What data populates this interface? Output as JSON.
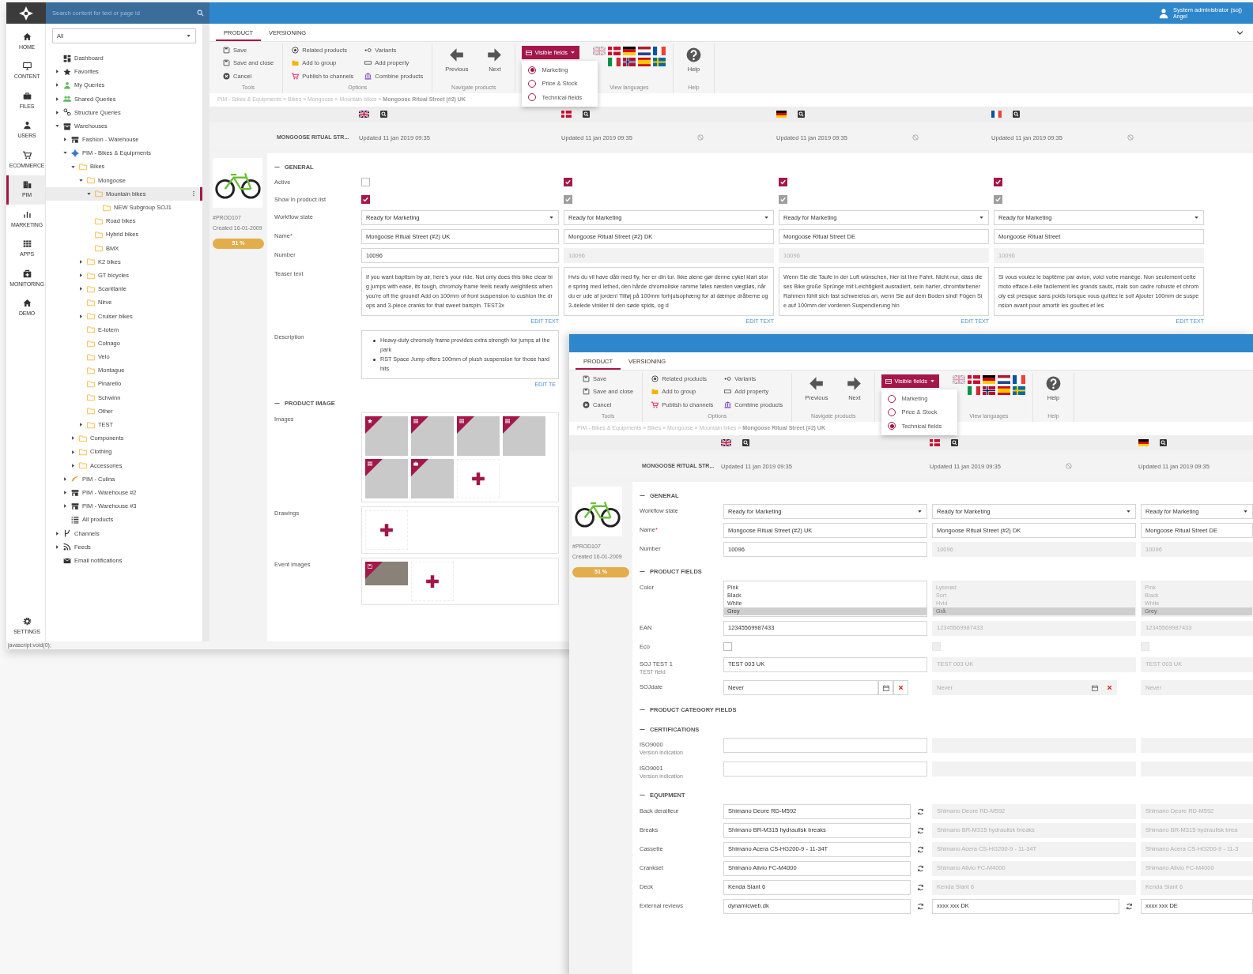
{
  "back_window": {
    "search": {
      "placeholder": "Search content for text or page id"
    },
    "user": {
      "name": "System administrator (soj)",
      "role": "Angel"
    },
    "rail": [
      {
        "label": "HOME",
        "kind": "home",
        "selected": false
      },
      {
        "label": "CONTENT",
        "kind": "monitor",
        "selected": false
      },
      {
        "label": "FILES",
        "kind": "briefcase",
        "selected": false
      },
      {
        "label": "USERS",
        "kind": "user",
        "selected": false
      },
      {
        "label": "ECOMMERCE",
        "kind": "cart",
        "selected": false
      },
      {
        "label": "PIM",
        "kind": "building",
        "selected": true
      },
      {
        "label": "MARKETING",
        "kind": "chart",
        "selected": false
      },
      {
        "label": "APPS",
        "kind": "grid",
        "selected": false
      },
      {
        "label": "MONITORING",
        "kind": "medkit",
        "selected": false
      },
      {
        "label": "DEMO",
        "kind": "home",
        "selected": false
      }
    ],
    "settings": {
      "label": "SETTINGS"
    },
    "tree_filter": {
      "value": "All"
    },
    "tree": [
      {
        "label": "Dashboard",
        "kind": "dashboard",
        "selected": false
      },
      {
        "label": "Favorites",
        "kind": "star",
        "selected": false,
        "expanded": false
      },
      {
        "label": "My Queries",
        "kind": "user",
        "selected": false,
        "expanded": false
      },
      {
        "label": "Shared Queries",
        "kind": "users",
        "selected": false,
        "expanded": false
      },
      {
        "label": "Structure Queries",
        "kind": "link",
        "selected": false,
        "expanded": false
      },
      {
        "label": "Warehouses",
        "kind": "archive",
        "selected": false,
        "expanded": true,
        "children": [
          {
            "label": "Fashion - Warehouse",
            "kind": "store",
            "selected": false,
            "expanded": false
          },
          {
            "label": "PIM - Bikes & Equipments",
            "kind": "logo",
            "selected": false,
            "expanded": true,
            "children": [
              {
                "label": "Bikes",
                "kind": "folder",
                "selected": false,
                "expanded": true,
                "children": [
                  {
                    "label": "Mongoose",
                    "kind": "folder",
                    "selected": false,
                    "expanded": true,
                    "children": [
                      {
                        "label": "Mountain bikes",
                        "kind": "folder",
                        "selected": true,
                        "expanded": true,
                        "children": [
                          {
                            "label": "NEW Subgroup SOJ1",
                            "kind": "folder",
                            "selected": false
                          }
                        ]
                      },
                      {
                        "label": "Road bikes",
                        "kind": "folder",
                        "selected": false
                      },
                      {
                        "label": "Hybrid bikes",
                        "kind": "folder",
                        "selected": false
                      },
                      {
                        "label": "BMX",
                        "kind": "folder",
                        "selected": false
                      }
                    ]
                  },
                  {
                    "label": "K2 bikes",
                    "kind": "folder",
                    "selected": false,
                    "expanded": false
                  },
                  {
                    "label": "GT bicycles",
                    "kind": "folder",
                    "selected": false,
                    "expanded": false
                  },
                  {
                    "label": "Scanttante",
                    "kind": "folder",
                    "selected": false,
                    "expanded": false
                  },
                  {
                    "label": "Nirve",
                    "kind": "folder",
                    "selected": false
                  },
                  {
                    "label": "Cruiser bikes",
                    "kind": "folder",
                    "selected": false,
                    "expanded": false
                  },
                  {
                    "label": "E-totem",
                    "kind": "folder",
                    "selected": false
                  },
                  {
                    "label": "Colnago",
                    "kind": "folder",
                    "selected": false
                  },
                  {
                    "label": "Velo",
                    "kind": "folder",
                    "selected": false
                  },
                  {
                    "label": "Montague",
                    "kind": "folder",
                    "selected": false
                  },
                  {
                    "label": "Pinarello",
                    "kind": "folder",
                    "selected": false
                  },
                  {
                    "label": "Schwinn",
                    "kind": "folder",
                    "selected": false
                  },
                  {
                    "label": "Other",
                    "kind": "folder",
                    "selected": false
                  },
                  {
                    "label": "TEST",
                    "kind": "folder",
                    "selected": false,
                    "expanded": false
                  }
                ]
              },
              {
                "label": "Components",
                "kind": "folder",
                "selected": false,
                "expanded": false
              },
              {
                "label": "Clothing",
                "kind": "folder",
                "selected": false,
                "expanded": false
              },
              {
                "label": "Accessories",
                "kind": "folder",
                "selected": false,
                "expanded": false
              }
            ]
          },
          {
            "label": "PIM - Culina",
            "kind": "culina",
            "selected": false,
            "expanded": false
          },
          {
            "label": "PIM - Warehouse #2",
            "kind": "store",
            "selected": false,
            "expanded": false
          },
          {
            "label": "PIM - Warehouse #3",
            "kind": "store",
            "selected": false,
            "expanded": false
          },
          {
            "label": "All products",
            "kind": "list",
            "selected": false
          }
        ]
      },
      {
        "label": "Channels",
        "kind": "branch",
        "selected": false,
        "expanded": false
      },
      {
        "label": "Feeds",
        "kind": "rss",
        "selected": false,
        "expanded": false
      },
      {
        "label": "Email notifications",
        "kind": "mail",
        "selected": false
      }
    ],
    "editor": {
      "tabs": [
        {
          "label": "PRODUCT",
          "selected": true
        },
        {
          "label": "VERSIONING",
          "selected": false
        }
      ],
      "toolbar": [
        {
          "kind": "list",
          "caption": "Tools",
          "columns": [
            [
              {
                "label": "Save",
                "kind": "save"
              },
              {
                "label": "Save and close",
                "kind": "save"
              },
              {
                "label": "Cancel",
                "kind": "cancel"
              }
            ]
          ]
        },
        {
          "kind": "list",
          "caption": "Options",
          "columns": [
            [
              {
                "label": "Related products",
                "kind": "related"
              },
              {
                "label": "Add to group",
                "kind": "folder-fill"
              },
              {
                "label": "Publish to channels",
                "kind": "cart"
              }
            ],
            [
              {
                "label": "Variants",
                "kind": "variants"
              },
              {
                "label": "Add property",
                "kind": "property"
              },
              {
                "label": "Combine products",
                "kind": "combine"
              }
            ]
          ]
        },
        {
          "kind": "big",
          "caption": "Navigate products",
          "items": [
            {
              "label": "Previous",
              "kind": "arrow-left"
            },
            {
              "label": "Next",
              "kind": "arrow-right"
            }
          ]
        },
        {
          "kind": "dropdown",
          "label": "Visible fields",
          "options": [
            {
              "label": "Marketing",
              "selected": true
            },
            {
              "label": "Price & Stock",
              "selected": false
            },
            {
              "label": "Technical fields",
              "selected": false
            }
          ]
        },
        {
          "kind": "flags",
          "caption": "View languages",
          "rows": [
            [
              {
                "kind": "uk",
                "faded": true
              },
              {
                "kind": "dk",
                "faded": false
              },
              {
                "kind": "de",
                "faded": false
              },
              {
                "kind": "nl",
                "faded": false
              },
              {
                "kind": "fr",
                "faded": false
              }
            ],
            [
              {
                "kind": "it",
                "faded": false
              },
              {
                "kind": "no",
                "faded": false
              },
              {
                "kind": "es",
                "faded": false
              },
              {
                "kind": "se",
                "faded": false
              }
            ]
          ]
        },
        {
          "kind": "big",
          "caption": "Help",
          "items": [
            {
              "label": "Help",
              "kind": "help"
            }
          ]
        }
      ],
      "breadcrumb": "PIM - Bikes & Equipments » Bikes » Mongoose » Mountain bikes » **Mongoose Ritual Street (#2) UK**",
      "title": "MONGOOSE RITUAL STR...",
      "columns": [
        {
          "kind": "uk",
          "updated": "Updated 11 jan 2019 09:35",
          "blocked": false
        },
        {
          "kind": "dk",
          "updated": "Updated 11 jan 2019 09:35",
          "blocked": true
        },
        {
          "kind": "de",
          "updated": "Updated 11 jan 2019 09:35",
          "blocked": true
        },
        {
          "kind": "fr",
          "updated": "Updated 11 jan 2019 09:35",
          "blocked": true
        }
      ],
      "product": {
        "id": "#PROD107",
        "created": "Created 16-01-2009",
        "completeness": "51 %"
      },
      "sections": [
        {
          "title": "GENERAL",
          "fields": [
            {
              "label": "Active",
              "kind": "checkbox",
              "values": [
                {
                  "checked": false,
                  "disabled": false
                },
                {
                  "checked": true,
                  "disabled": false
                },
                {
                  "checked": true,
                  "disabled": false
                },
                {
                  "checked": true,
                  "disabled": false
                }
              ]
            },
            {
              "label": "Show in product list",
              "kind": "checkbox",
              "values": [
                {
                  "checked": true,
                  "disabled": false
                },
                {
                  "checked": true,
                  "disabled": true
                },
                {
                  "checked": true,
                  "disabled": true
                },
                {
                  "checked": true,
                  "disabled": true
                }
              ]
            },
            {
              "label": "Workflow state",
              "kind": "select",
              "values": [
                {
                  "value": "Ready for Marketing",
                  "disabled": false
                },
                {
                  "value": "Ready for Marketing",
                  "disabled": false
                },
                {
                  "value": "Ready for Marketing",
                  "disabled": false
                },
                {
                  "value": "Ready for Marketing",
                  "disabled": false
                }
              ]
            },
            {
              "label": "Name",
              "required_mark": "*",
              "kind": "text",
              "values": [
                {
                  "value": "Mongoose Ritual Street (#2) UK",
                  "disabled": false
                },
                {
                  "value": "Mongoose Ritual Street (#2) DK",
                  "disabled": false
                },
                {
                  "value": "Mongoose Ritual Street DE",
                  "disabled": false
                },
                {
                  "value": "Mongoose Ritual Street",
                  "disabled": false
                }
              ]
            },
            {
              "label": "Number",
              "kind": "text",
              "values": [
                {
                  "value": "10096",
                  "disabled": false
                },
                {
                  "value": "10096",
                  "disabled": true
                },
                {
                  "value": "10096",
                  "disabled": true
                },
                {
                  "value": "10096",
                  "disabled": true
                }
              ]
            },
            {
              "label": "Teaser text",
              "kind": "textarea",
              "values": [
                {
                  "value": "If you want baptism by air, here's your ride. Not only does this bike clear big jumps with ease, its tough, chromoly frame feels nearly weightless when you're off the ground! Add on 100mm of front suspension to cushion the drops and 3-piece cranks for that sweet barspin. TEST3x",
                  "action": "EDIT TEXT"
                },
                {
                  "value": "Hvis du vil have dåb med fly, her er din tur. Ikke alene gør denne cykel klart store spring med lethed, den hårde chromoliske ramme føles næsten vægtløs, når du er ude af jorden! Tilføj på 100mm forhjulsophæng for at dæmpe dråberne og 3-delede vinkler til den søde spids, og d",
                  "action": "EDIT TEXT"
                },
                {
                  "value": "Wenn Sie die Taufe in der Luft wünschen, hier ist Ihre Fahrt. Nicht nur, dass dieses Bike große Sprünge mit Leichtigkeit ausradiert, sein harter, chromfarbener Rahmen fühlt sich fast schwerelos an, wenn Sie auf dem Boden sind! Fügen Sie auf 100mm der vorderen Suspendierung hin",
                  "action": "EDIT TEXT"
                },
                {
                  "value": "Si vous voulez le baptême par avion, voici votre manège. Non seulement cette moto efface-t-elle facilement les grands sauts, mais son cadre robuste et chromoly est presque sans poids lorsque vous quittez le sol! Ajouter 100mm de suspension avant pour amortir les gouttes et les",
                  "action": "EDIT TEXT"
                }
              ]
            },
            {
              "label": "Description",
              "kind": "richtext",
              "values": [
                {
                  "items": [
                    "Heavy-duty chromoly frame provides extra strength for jumps at the park",
                    "RST Space Jump offers 100mm of plush suspension for those hard hits"
                  ],
                  "action": "EDIT TE"
                }
              ]
            }
          ]
        },
        {
          "title": "PRODUCT IMAGE",
          "fields": [
            {
              "label": "Images",
              "kind": "gallery",
              "values": [
                {
                  "tiles": [
                    {
                      "kind": "starred"
                    },
                    {
                      "kind": "photo"
                    },
                    {
                      "kind": "photo"
                    },
                    {
                      "kind": "photo"
                    },
                    {
                      "kind": "photo"
                    },
                    {
                      "kind": "camera"
                    },
                    {
                      "kind": "add"
                    }
                  ]
                }
              ]
            },
            {
              "label": "Drawings",
              "kind": "gallery",
              "values": [
                {
                  "tiles": [
                    {
                      "kind": "add"
                    }
                  ]
                }
              ]
            },
            {
              "label": "Event images",
              "kind": "gallery",
              "values": [
                {
                  "tiles": [
                    {
                      "kind": "event"
                    },
                    {
                      "kind": "add"
                    }
                  ]
                }
              ]
            }
          ]
        }
      ]
    }
  },
  "status_bar": "javascript:void(0);",
  "front_window": {
    "editor": {
      "tabs": [
        {
          "label": "PRODUCT",
          "selected": true
        },
        {
          "label": "VERSIONING",
          "selected": false
        }
      ],
      "toolbar": [
        {
          "kind": "list",
          "caption": "Tools",
          "columns": [
            [
              {
                "label": "Save",
                "kind": "save"
              },
              {
                "label": "Save and close",
                "kind": "save"
              },
              {
                "label": "Cancel",
                "kind": "cancel"
              }
            ]
          ]
        },
        {
          "kind": "list",
          "caption": "Options",
          "columns": [
            [
              {
                "label": "Related products",
                "kind": "related"
              },
              {
                "label": "Add to group",
                "kind": "folder-fill"
              },
              {
                "label": "Publish to channels",
                "kind": "cart"
              }
            ],
            [
              {
                "label": "Variants",
                "kind": "variants"
              },
              {
                "label": "Add property",
                "kind": "property"
              },
              {
                "label": "Combine products",
                "kind": "combine"
              }
            ]
          ]
        },
        {
          "kind": "big",
          "caption": "Navigate products",
          "items": [
            {
              "label": "Previous",
              "kind": "arrow-left"
            },
            {
              "label": "Next",
              "kind": "arrow-right"
            }
          ]
        },
        {
          "kind": "dropdown",
          "label": "Visible fields",
          "options": [
            {
              "label": "Marketing",
              "selected": false
            },
            {
              "label": "Price & Stock",
              "selected": false
            },
            {
              "label": "Technical fields",
              "selected": true
            }
          ]
        },
        {
          "kind": "flags",
          "caption": "View languages",
          "rows": [
            [
              {
                "kind": "uk",
                "faded": true
              },
              {
                "kind": "dk",
                "faded": false
              },
              {
                "kind": "de",
                "faded": false
              },
              {
                "kind": "nl",
                "faded": false
              },
              {
                "kind": "fr",
                "faded": false
              }
            ],
            [
              {
                "kind": "it",
                "faded": false
              },
              {
                "kind": "no",
                "faded": false
              },
              {
                "kind": "es",
                "faded": false
              },
              {
                "kind": "se",
                "faded": false
              }
            ]
          ]
        },
        {
          "kind": "big",
          "caption": "Help",
          "items": [
            {
              "label": "Help",
              "kind": "help"
            }
          ]
        }
      ],
      "breadcrumb": "PIM - Bikes & Equipments » Bikes » Mongoose » Mountain bikes » **Mongoose Ritual Street (#2) UK**",
      "title": "MONGOOSE RITUAL STR...",
      "columns": [
        {
          "kind": "uk",
          "updated": "Updated 11 jan 2019 09:35",
          "blocked": false
        },
        {
          "kind": "dk",
          "updated": "Updated 11 jan 2019 09:35",
          "blocked": true
        },
        {
          "kind": "de",
          "updated": "Updated 11 jan 2019 09:35",
          "blocked": false
        }
      ],
      "product": {
        "id": "#PROD107",
        "created": "Created 16-01-2009",
        "completeness": "51 %"
      },
      "sections": [
        {
          "title": "GENERAL",
          "fields": [
            {
              "label": "Workflow state",
              "kind": "select",
              "values": [
                {
                  "value": "Ready for Marketing",
                  "disabled": false
                },
                {
                  "value": "Ready for Marketing",
                  "disabled": false
                },
                {
                  "value": "Ready for Marketing",
                  "disabled": false
                }
              ]
            },
            {
              "label": "Name",
              "required_mark": "*",
              "kind": "text",
              "values": [
                {
                  "value": "Mongoose Ritual Street (#2) UK",
                  "disabled": false
                },
                {
                  "value": "Mongoose Ritual Street (#2) DK",
                  "disabled": false
                },
                {
                  "value": "Mongoose Ritual Street DE",
                  "disabled": false
                }
              ]
            },
            {
              "label": "Number",
              "kind": "text",
              "values": [
                {
                  "value": "10096",
                  "disabled": false
                },
                {
                  "value": "10096",
                  "disabled": true
                },
                {
                  "value": "10096",
                  "disabled": true
                }
              ]
            }
          ]
        },
        {
          "title": "PRODUCT FIELDS",
          "fields": [
            {
              "label": "Color",
              "kind": "listbox",
              "values": [
                {
                  "disabled": false,
                  "options": [
                    {
                      "label": "Pink",
                      "selected": false
                    },
                    {
                      "label": "Black",
                      "selected": false
                    },
                    {
                      "label": "White",
                      "selected": false
                    },
                    {
                      "label": "Grey",
                      "selected": true
                    }
                  ]
                },
                {
                  "disabled": true,
                  "options": [
                    {
                      "label": "Lyserød",
                      "selected": false
                    },
                    {
                      "label": "Sort",
                      "selected": false
                    },
                    {
                      "label": "Hvid",
                      "selected": false
                    },
                    {
                      "label": "Grå",
                      "selected": true
                    }
                  ]
                },
                {
                  "disabled": true,
                  "options": [
                    {
                      "label": "Pink",
                      "selected": false
                    },
                    {
                      "label": "Black",
                      "selected": false
                    },
                    {
                      "label": "White",
                      "selected": false
                    },
                    {
                      "label": "Grey",
                      "selected": true
                    }
                  ]
                }
              ]
            },
            {
              "label": "EAN",
              "kind": "text",
              "values": [
                {
                  "value": "12345569987433",
                  "disabled": false
                },
                {
                  "value": "12345569987433",
                  "disabled": true
                },
                {
                  "value": "12345569987433",
                  "disabled": true
                }
              ]
            },
            {
              "label": "Eco",
              "kind": "checkbox",
              "values": [
                {
                  "checked": false,
                  "disabled": false
                },
                {
                  "checked": false,
                  "disabled": true
                },
                {
                  "checked": false,
                  "disabled": true
                }
              ]
            },
            {
              "label": "SOJ TEST 1",
              "hint": "TEST field",
              "kind": "text",
              "values": [
                {
                  "value": "TEST 003 UK",
                  "disabled": false
                },
                {
                  "value": "TEST 003 UK",
                  "disabled": true
                },
                {
                  "value": "TEST 003 UK",
                  "disabled": true
                }
              ]
            },
            {
              "label": "SOJdate",
              "kind": "date",
              "values": [
                {
                  "value": "Never",
                  "disabled": false,
                  "picker": true
                },
                {
                  "value": "Never",
                  "disabled": true,
                  "picker": true
                },
                {
                  "value": "Never",
                  "disabled": true,
                  "picker": false
                }
              ]
            }
          ]
        },
        {
          "title": "PRODUCT CATEGORY FIELDS"
        },
        {
          "title": "CERTIFICATIONS",
          "fields": [
            {
              "label": "ISO9000",
              "hint": "Version indication",
              "kind": "text",
              "values": [
                {
                  "disabled": false
                },
                {
                  "disabled": true
                },
                {
                  "disabled": true
                }
              ]
            },
            {
              "label": "ISO9001",
              "hint": "Version indication",
              "kind": "text",
              "values": [
                {
                  "disabled": false
                },
                {
                  "disabled": true
                },
                {
                  "disabled": true
                }
              ]
            }
          ]
        },
        {
          "title": "EQUIPMENT",
          "fields": [
            {
              "label": "Back derailleur",
              "kind": "text",
              "values": [
                {
                  "value": "Shimano Deore RD-M592",
                  "disabled": false,
                  "sync": true
                },
                {
                  "value": "Shimano Deore RD-M592",
                  "disabled": true,
                  "sync": false
                },
                {
                  "value": "Shimano Deore RD-M592",
                  "disabled": true,
                  "sync": false
                }
              ]
            },
            {
              "label": "Breaks",
              "kind": "text",
              "values": [
                {
                  "value": "Shimano BR-M315 hydraulisk breaks",
                  "disabled": false,
                  "sync": true
                },
                {
                  "value": "Shimano BR-M315 hydraulisk breaks",
                  "disabled": true,
                  "sync": false
                },
                {
                  "value": "Shimano BR-M315 hydraulisk brea",
                  "disabled": true,
                  "sync": false
                }
              ]
            },
            {
              "label": "Cassette",
              "kind": "text",
              "values": [
                {
                  "value": "Shimano Acera CS-HG200-9 - 11-34T",
                  "disabled": false,
                  "sync": true
                },
                {
                  "value": "Shimano Acera CS-HG200-9 - 11-34T",
                  "disabled": true,
                  "sync": false
                },
                {
                  "value": "Shimano Acera CS-HG200-9 - 11-3",
                  "disabled": true,
                  "sync": false
                }
              ]
            },
            {
              "label": "Crankset",
              "kind": "text",
              "values": [
                {
                  "value": "Shimano Alivio FC-M4000",
                  "disabled": false,
                  "sync": true
                },
                {
                  "value": "Shimano Alivio FC-M4000",
                  "disabled": true,
                  "sync": false
                },
                {
                  "value": "Shimano Alivio FC-M4000",
                  "disabled": true,
                  "sync": false
                }
              ]
            },
            {
              "label": "Deck",
              "kind": "text",
              "values": [
                {
                  "value": "Kenda Slant 6",
                  "disabled": false,
                  "sync": true
                },
                {
                  "value": "Kenda Slant 6",
                  "disabled": true,
                  "sync": false
                },
                {
                  "value": "Kenda Slant 6",
                  "disabled": true,
                  "sync": false
                }
              ]
            },
            {
              "label": "External reviews",
              "kind": "text",
              "values": [
                {
                  "value": "dynamicweb.dk",
                  "disabled": false,
                  "sync": true
                },
                {
                  "value": "xxxx xxx DK",
                  "disabled": false,
                  "sync": true
                },
                {
                  "value": "xxxx xxx DE",
                  "disabled": false,
                  "sync": false
                }
              ]
            }
          ]
        }
      ]
    }
  }
}
